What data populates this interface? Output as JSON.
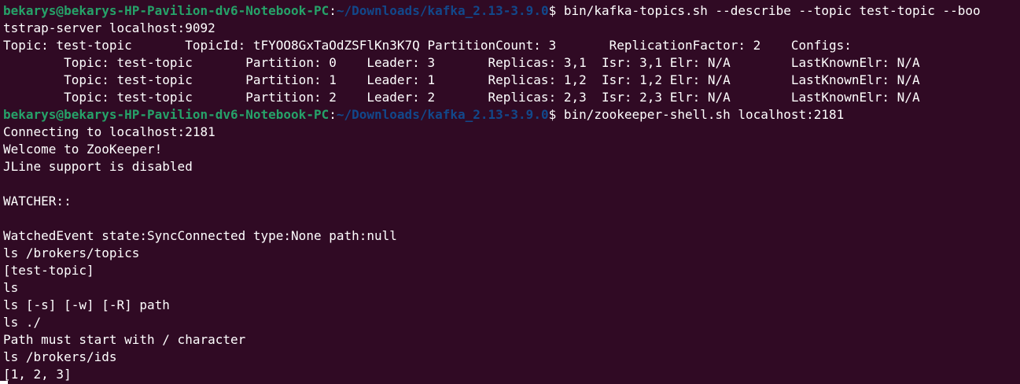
{
  "colors": {
    "background": "#300a24",
    "text": "#ffffff",
    "prompt_user": "#26a269",
    "prompt_path": "#12488b"
  },
  "lines": [
    {
      "kind": "prompt",
      "user": "bekarys@bekarys-HP-Pavilion-dv6-Notebook-PC",
      "sep": ":",
      "path": "~/Downloads/kafka_2.13-3.9.0",
      "sign": "$ ",
      "command": "bin/kafka-topics.sh --describe --topic test-topic --boo"
    },
    {
      "kind": "output",
      "text": "tstrap-server localhost:9092"
    },
    {
      "kind": "output",
      "text": "Topic: test-topic       TopicId: tFYOO8GxTaOdZSFlKn3K7Q PartitionCount: 3       ReplicationFactor: 2    Configs:"
    },
    {
      "kind": "output",
      "text": "        Topic: test-topic       Partition: 0    Leader: 3       Replicas: 3,1  Isr: 3,1 Elr: N/A        LastKnownElr: N/A"
    },
    {
      "kind": "output",
      "text": "        Topic: test-topic       Partition: 1    Leader: 1       Replicas: 1,2  Isr: 1,2 Elr: N/A        LastKnownElr: N/A"
    },
    {
      "kind": "output",
      "text": "        Topic: test-topic       Partition: 2    Leader: 2       Replicas: 2,3  Isr: 2,3 Elr: N/A        LastKnownElr: N/A"
    },
    {
      "kind": "prompt",
      "user": "bekarys@bekarys-HP-Pavilion-dv6-Notebook-PC",
      "sep": ":",
      "path": "~/Downloads/kafka_2.13-3.9.0",
      "sign": "$ ",
      "command": "bin/zookeeper-shell.sh localhost:2181"
    },
    {
      "kind": "output",
      "text": "Connecting to localhost:2181"
    },
    {
      "kind": "output",
      "text": "Welcome to ZooKeeper!"
    },
    {
      "kind": "output",
      "text": "JLine support is disabled"
    },
    {
      "kind": "output",
      "text": ""
    },
    {
      "kind": "output",
      "text": "WATCHER::"
    },
    {
      "kind": "output",
      "text": ""
    },
    {
      "kind": "output",
      "text": "WatchedEvent state:SyncConnected type:None path:null"
    },
    {
      "kind": "output",
      "text": "ls /brokers/topics"
    },
    {
      "kind": "output",
      "text": "[test-topic]"
    },
    {
      "kind": "output",
      "text": "ls"
    },
    {
      "kind": "output",
      "text": "ls [-s] [-w] [-R] path"
    },
    {
      "kind": "output",
      "text": "ls ./"
    },
    {
      "kind": "output",
      "text": "Path must start with / character"
    },
    {
      "kind": "output",
      "text": "ls /brokers/ids"
    },
    {
      "kind": "output",
      "text": "[1, 2, 3]"
    }
  ]
}
